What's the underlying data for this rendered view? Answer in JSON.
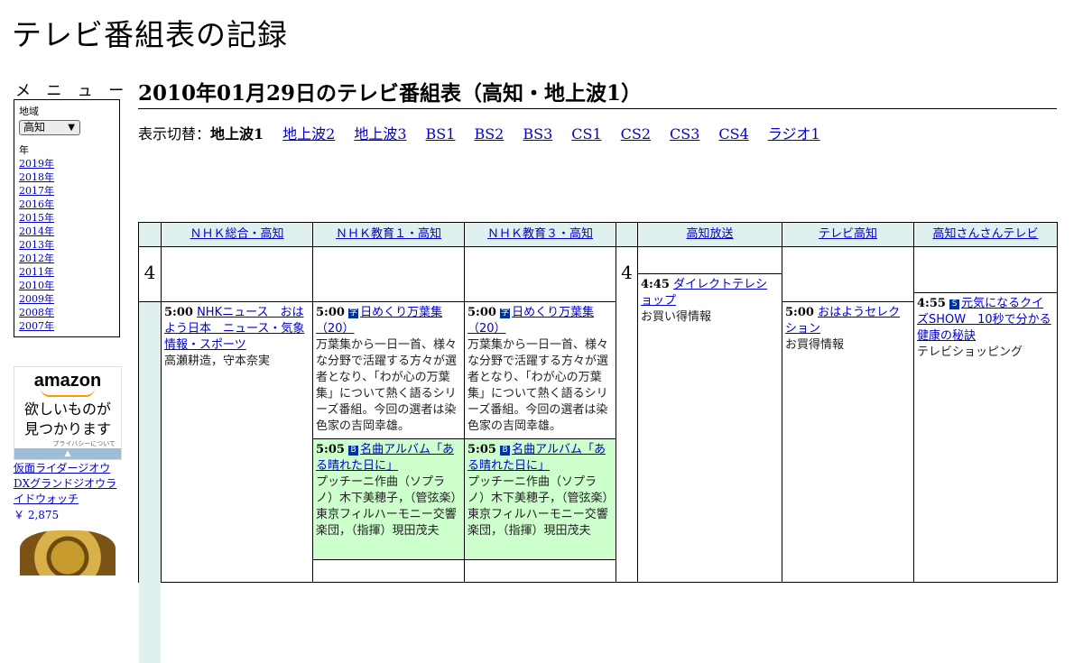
{
  "site": {
    "title": "テレビ番組表の記録"
  },
  "sidebar": {
    "heading": "メ ニ ュ ー",
    "region_label": "地域",
    "region_value": "高知",
    "year_label": "年",
    "years": [
      "2019年",
      "2018年",
      "2017年",
      "2016年",
      "2015年",
      "2014年",
      "2013年",
      "2012年",
      "2011年",
      "2010年",
      "2009年",
      "2008年",
      "2007年"
    ]
  },
  "ad": {
    "logo": "amazon",
    "text_line1": "欲しいものが",
    "text_line2": "見つかります",
    "privacy": "プライバシーについて",
    "product_name": "仮面ライダージオウ DXグランドジオウライドウォッチ",
    "product_price": "￥ 2,875"
  },
  "page": {
    "heading": "2010年01月29日のテレビ番組表（高知・地上波1）",
    "switch_label": "表示切替：",
    "current": "地上波1",
    "links": [
      "地上波2",
      "地上波3",
      "BS1",
      "BS2",
      "BS3",
      "CS1",
      "CS2",
      "CS3",
      "CS4",
      "ラジオ1"
    ]
  },
  "grid": {
    "hour": "4",
    "channels": [
      "ＮＨＫ総合・高知",
      "ＮＨＫ教育１・高知",
      "ＮＨＫ教育３・高知",
      "高知放送",
      "テレビ高知",
      "高知さんさんテレビ"
    ],
    "nhk_g": {
      "time": "5:00",
      "title": "NHKニュース　おはよう日本　ニュース・気象情報・スポーツ",
      "desc": "高瀬耕造，守本奈実"
    },
    "edu1_a": {
      "time": "5:00",
      "badge": "字",
      "title": "日めくり万葉集（20）",
      "desc": "万葉集から一日一首、様々な分野で活躍する方々が選者となり、「わが心の万葉集」について熱く語るシリーズ番組。今回の選者は染色家の吉岡幸雄。"
    },
    "edu1_b": {
      "time": "5:05",
      "badge": "B",
      "title": "名曲アルバム「ある晴れた日に」",
      "desc": "プッチーニ作曲（ソプラノ）木下美穂子，（管弦楽）東京フィルハーモニー交響楽団，（指揮）現田茂夫"
    },
    "edu3_a": {
      "time": "5:00",
      "badge": "字",
      "title": "日めくり万葉集（20）",
      "desc": "万葉集から一日一首、様々な分野で活躍する方々が選者となり、「わが心の万葉集」について熱く語るシリーズ番組。今回の選者は染色家の吉岡幸雄。"
    },
    "edu3_b": {
      "time": "5:05",
      "badge": "B",
      "title": "名曲アルバム「ある晴れた日に」",
      "desc": "プッチーニ作曲（ソプラノ）木下美穂子，（管弦楽）東京フィルハーモニー交響楽団，（指揮）現田茂夫"
    },
    "rkc": {
      "time": "4:45",
      "title": "ダイレクトテレショップ",
      "desc": "お買い得情報"
    },
    "kutv": {
      "time": "5:00",
      "title": "おはようセレクション",
      "desc": "お買得情報"
    },
    "kss": {
      "time": "4:55",
      "badge": "S",
      "title": "元気になるクイズSHOW　10秒で分かる健康の秘訣",
      "desc": "テレビショッピング"
    }
  }
}
